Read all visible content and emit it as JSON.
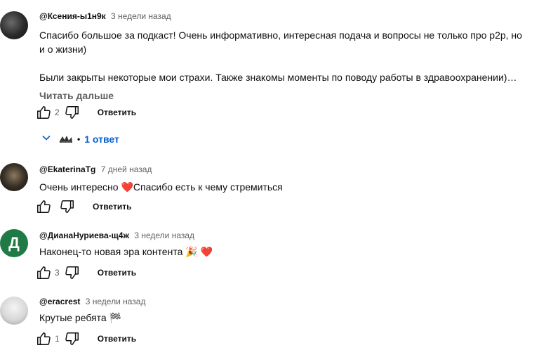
{
  "comments": [
    {
      "author": "@Ксения-ы1н9к",
      "time": "3 недели назад",
      "lines": [
        "Спасибо большое за подкаст! Очень информативно, интересная подача и вопросы не только про p2p, но",
        "и о жизни)",
        "",
        "Были закрыты некоторые мои страхи. Также знакомы моменты по поводу работы в здравоохранении)…"
      ],
      "read_more": "Читать дальше",
      "likes": "2",
      "reply_label": "Ответить",
      "replies_label": "1 ответ",
      "replies_sep": "•"
    },
    {
      "author": "@EkaterinaTg",
      "time": "7 дней назад",
      "text_before": "Очень интересно ",
      "emoji": "❤️",
      "text_after": "Спасибо есть к чему стремиться",
      "likes": "",
      "reply_label": "Ответить"
    },
    {
      "author": "@ДианаНуриева-щ4ж",
      "time": "3 недели назад",
      "avatar_letter": "Д",
      "text_before": "Наконец-то новая эра контента ",
      "emoji": "🎉 ❤️",
      "likes": "3",
      "reply_label": "Ответить"
    },
    {
      "author": "@eracrest",
      "time": "3 недели назад",
      "text_before": "Крутые ребята ",
      "emoji": "🏁",
      "likes": "1",
      "reply_label": "Ответить"
    }
  ]
}
